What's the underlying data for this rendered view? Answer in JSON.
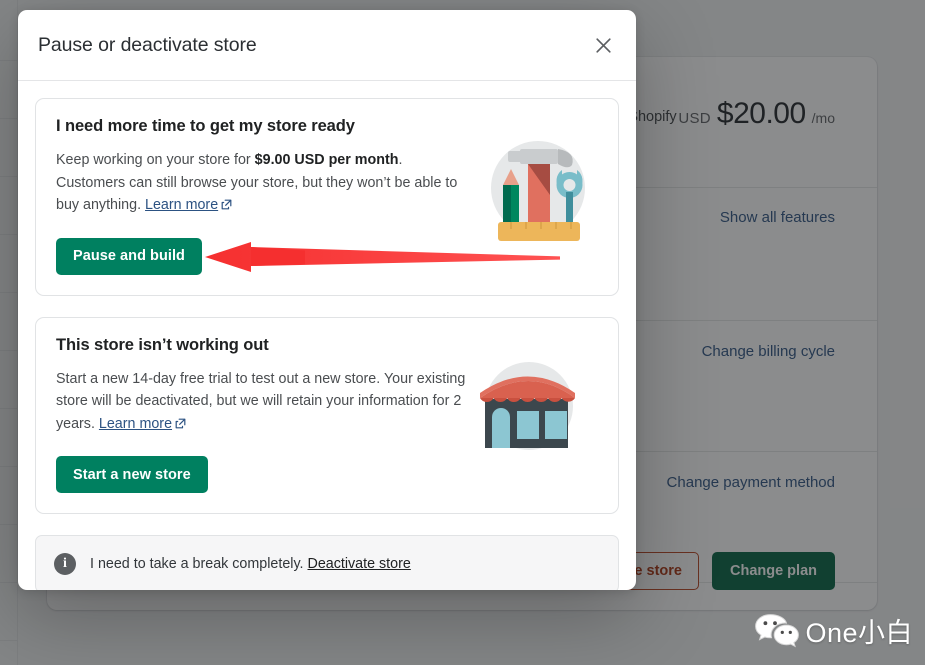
{
  "background": {
    "plan": {
      "description_fragment": "d the Shopify",
      "currency": "USD",
      "amount": "$20.00",
      "period": "/mo"
    },
    "links": {
      "show_all_features": "Show all features",
      "change_billing_cycle": "Change billing cycle",
      "change_payment_method": "Change payment method"
    },
    "footer_buttons": {
      "pause_or_deactivate": "Pause or deactivate store",
      "change_plan": "Change plan"
    },
    "colors": {
      "danger_outline": "#b8411f",
      "danger_text": "#a9310d",
      "green_solid": "#00603f",
      "link": "#2c5282"
    }
  },
  "modal": {
    "title": "Pause or deactivate store",
    "close_icon": "close-icon",
    "options": [
      {
        "title": "I need more time to get my store ready",
        "desc_before": "Keep working on your store for ",
        "desc_bold": "$9.00 USD per month",
        "desc_after": ". Customers can still browse your store, but they won’t be able to buy anything. ",
        "link": "Learn more",
        "link_icon": "external-link-icon",
        "button": "Pause and build",
        "art": "tools-illustration"
      },
      {
        "title": "This store isn’t working out",
        "desc_before": "Start a new 14-day free trial to test out a new store. Your existing store will be deactivated, but we will retain your information for 2 years. ",
        "desc_bold": "",
        "desc_after": "",
        "link": "Learn more",
        "link_icon": "external-link-icon",
        "button": "Start a new store",
        "art": "storefront-illustration"
      }
    ],
    "info_banner": {
      "icon": "info-icon",
      "text": "I need to take a break completely. ",
      "link": "Deactivate store"
    },
    "colors": {
      "primary_button": "#008060",
      "link": "#2c5282"
    }
  },
  "annotation": {
    "arrow": "red-left-arrow",
    "color": "#f73030"
  },
  "watermark": {
    "icon": "wechat-icon",
    "text": "One小白"
  }
}
